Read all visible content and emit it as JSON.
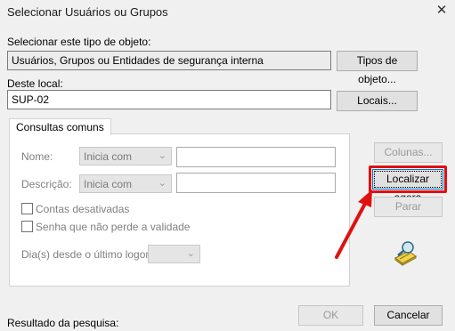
{
  "dialog": {
    "title": "Selecionar Usuários ou Grupos",
    "close_icon": "close-icon"
  },
  "object_type": {
    "label": "Selecionar este tipo de objeto:",
    "value": "Usuários, Grupos ou Entidades de segurança interna",
    "button": "Tipos de objeto..."
  },
  "location": {
    "label": "Deste local:",
    "value": "SUP-02",
    "button": "Locais..."
  },
  "tab": {
    "label": "Consultas comuns"
  },
  "query": {
    "name_label": "Nome:",
    "name_mode": "Inicia com",
    "name_value": "",
    "description_label": "Descrição:",
    "description_mode": "Inicia com",
    "description_value": "",
    "disabled_accounts": "Contas desativadas",
    "non_expiring_password": "Senha que não perde a validade",
    "days_since_logon": "Dia(s) desde o último logon:",
    "days_value": ""
  },
  "side_buttons": {
    "columns": "Colunas...",
    "find_now": "Localizar agora",
    "stop": "Parar",
    "search_icon": "search-flashlight-icon"
  },
  "results_label": "Resultado da pesquisa:",
  "footer": {
    "ok": "OK",
    "cancel": "Cancelar"
  },
  "colors": {
    "highlight": "#e01010",
    "focus": "#0078d7"
  }
}
